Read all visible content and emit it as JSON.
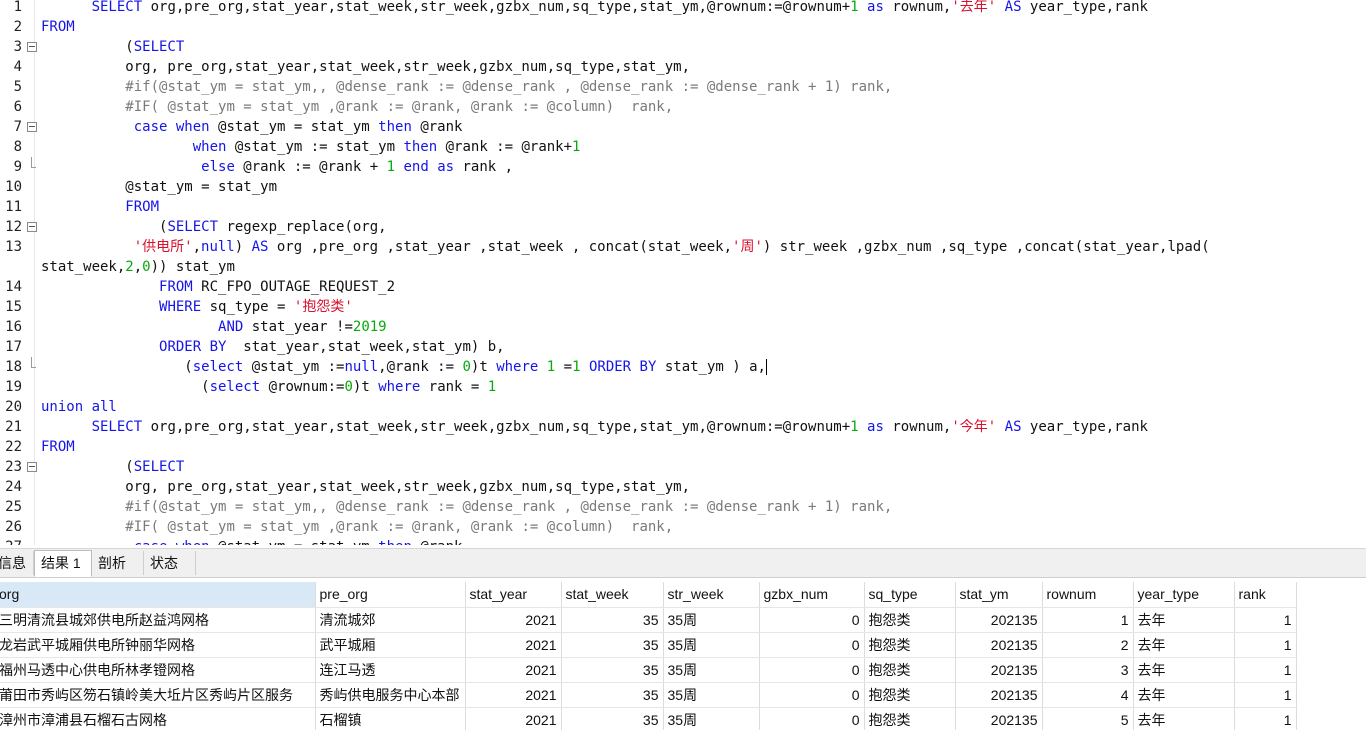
{
  "editor": {
    "lines": [
      {
        "n": "1",
        "fold": "",
        "code": "      <span class=\"kw\">SELECT</span> org,pre_org,stat_year,stat_week,str_week,gzbx_num,sq_type,stat_ym,@rownum:=@rownum+<span class=\"num\">1</span> <span class=\"kw\">as</span> rownum,<span class=\"str\">'去年'</span> <span class=\"kw\">AS</span> year_type,rank"
      },
      {
        "n": "2",
        "fold": "",
        "code": "<span class=\"kw\">FROM</span>"
      },
      {
        "n": "3",
        "fold": "open",
        "code": "          (<span class=\"kw\">SELECT</span>"
      },
      {
        "n": "4",
        "fold": "",
        "code": "          org, pre_org,stat_year,stat_week,str_week,gzbx_num,sq_type,stat_ym,"
      },
      {
        "n": "5",
        "fold": "",
        "code": "          <span class=\"cm\">#if(@stat_ym = stat_ym,, @dense_rank := @dense_rank , @dense_rank := @dense_rank + 1) rank,</span>"
      },
      {
        "n": "6",
        "fold": "",
        "code": "          <span class=\"cm\">#IF( @stat_ym = stat_ym ,@rank := @rank, @rank := @column)  rank,</span>"
      },
      {
        "n": "7",
        "fold": "open",
        "code": "           <span class=\"kw\">case</span> <span class=\"kw\">when</span> @stat_ym = stat_ym <span class=\"kw\">then</span> @rank"
      },
      {
        "n": "8",
        "fold": "",
        "code": "                  <span class=\"kw\">when</span> @stat_ym := stat_ym <span class=\"kw\">then</span> @rank := @rank+<span class=\"num\">1</span>"
      },
      {
        "n": "9",
        "fold": "end",
        "code": "                   <span class=\"kw\">else</span> @rank := @rank + <span class=\"num\">1</span> <span class=\"kw\">end</span> <span class=\"kw\">as</span> rank ,"
      },
      {
        "n": "10",
        "fold": "",
        "code": "          @stat_ym = stat_ym"
      },
      {
        "n": "11",
        "fold": "",
        "code": "          <span class=\"kw\">FROM</span>"
      },
      {
        "n": "12",
        "fold": "open",
        "code": "              (<span class=\"kw\">SELECT</span> regexp_replace(org,"
      },
      {
        "n": "13",
        "fold": "",
        "code": "           <span class=\"str\">'供电所'</span>,<span class=\"kw\">null</span>) <span class=\"kw\">AS</span> org ,pre_org ,stat_year ,stat_week , concat(stat_week,<span class=\"str\">'周'</span>) str_week ,gzbx_num ,sq_type ,concat(stat_year,lpad("
      },
      {
        "n": "",
        "fold": "wrap",
        "code": "stat_week,<span class=\"num\">2</span>,<span class=\"num\">0</span>)) stat_ym"
      },
      {
        "n": "14",
        "fold": "",
        "code": "              <span class=\"kw\">FROM</span> RC_FPO_OUTAGE_REQUEST_2"
      },
      {
        "n": "15",
        "fold": "",
        "code": "              <span class=\"kw\">WHERE</span> sq_type = <span class=\"str\">'抱怨类'</span>"
      },
      {
        "n": "16",
        "fold": "",
        "code": "                     <span class=\"kw\">AND</span> stat_year !=<span class=\"num\">2019</span>"
      },
      {
        "n": "17",
        "fold": "",
        "code": "              <span class=\"kw\">ORDER BY</span>  stat_year,stat_week,stat_ym) b,"
      },
      {
        "n": "18",
        "fold": "end",
        "code": "                 (<span class=\"kw\">select</span> @stat_ym :=<span class=\"kw\">null</span>,@rank := <span class=\"num\">0</span>)t <span class=\"kw\">where</span> <span class=\"num\">1</span> =<span class=\"num\">1</span> <span class=\"kw\">ORDER BY</span> stat_ym ) a,<span class=\"caret\"></span>"
      },
      {
        "n": "19",
        "fold": "",
        "code": "                   (<span class=\"kw\">select</span> @rownum:=<span class=\"num\">0</span>)t <span class=\"kw\">where</span> rank = <span class=\"num\">1</span>"
      },
      {
        "n": "20",
        "fold": "",
        "code": "<span class=\"kw\">union all</span>"
      },
      {
        "n": "21",
        "fold": "",
        "code": "      <span class=\"kw\">SELECT</span> org,pre_org,stat_year,stat_week,str_week,gzbx_num,sq_type,stat_ym,@rownum:=@rownum+<span class=\"num\">1</span> <span class=\"kw\">as</span> rownum,<span class=\"str\">'今年'</span> <span class=\"kw\">AS</span> year_type,rank"
      },
      {
        "n": "22",
        "fold": "",
        "code": "<span class=\"kw\">FROM</span>"
      },
      {
        "n": "23",
        "fold": "open",
        "code": "          (<span class=\"kw\">SELECT</span>"
      },
      {
        "n": "24",
        "fold": "",
        "code": "          org, pre_org,stat_year,stat_week,str_week,gzbx_num,sq_type,stat_ym,"
      },
      {
        "n": "25",
        "fold": "",
        "code": "          <span class=\"cm\">#if(@stat_ym = stat_ym,, @dense_rank := @dense_rank , @dense_rank := @dense_rank + 1) rank,</span>"
      },
      {
        "n": "26",
        "fold": "",
        "code": "          <span class=\"cm\">#IF( @stat_ym = stat_ym ,@rank := @rank, @rank := @column)  rank,</span>"
      },
      {
        "n": "27",
        "fold": "",
        "code": "           <span class=\"kw\">case</span> <span class=\"kw\">when</span> @stat_ym = stat_ym <span class=\"kw\">then</span> @rank"
      }
    ]
  },
  "tabs": [
    {
      "label": "信息",
      "active": false
    },
    {
      "label": "结果 1",
      "active": true
    },
    {
      "label": "剖析",
      "active": false
    },
    {
      "label": "状态",
      "active": false
    }
  ],
  "grid": {
    "columns": [
      "org",
      "pre_org",
      "stat_year",
      "stat_week",
      "str_week",
      "gzbx_num",
      "sq_type",
      "stat_ym",
      "rownum",
      "year_type",
      "rank"
    ],
    "rows": [
      [
        "三明清流县城郊供电所赵益鸿网格",
        "清流城郊",
        "2021",
        "35",
        "35周",
        "0",
        "抱怨类",
        "202135",
        "1",
        "去年",
        "1"
      ],
      [
        "龙岩武平城厢供电所钟丽华网格",
        "武平城厢",
        "2021",
        "35",
        "35周",
        "0",
        "抱怨类",
        "202135",
        "2",
        "去年",
        "1"
      ],
      [
        "福州马透中心供电所林孝镫网格",
        "连江马透",
        "2021",
        "35",
        "35周",
        "0",
        "抱怨类",
        "202135",
        "3",
        "去年",
        "1"
      ],
      [
        "莆田市秀屿区笏石镇岭美大坵片区秀屿片区服务",
        "秀屿供电服务中心本部",
        "2021",
        "35",
        "35周",
        "0",
        "抱怨类",
        "202135",
        "4",
        "去年",
        "1"
      ],
      [
        "漳州市漳浦县石榴石古网格",
        "石榴镇",
        "2021",
        "35",
        "35周",
        "0",
        "抱怨类",
        "202135",
        "5",
        "去年",
        "1"
      ]
    ]
  }
}
